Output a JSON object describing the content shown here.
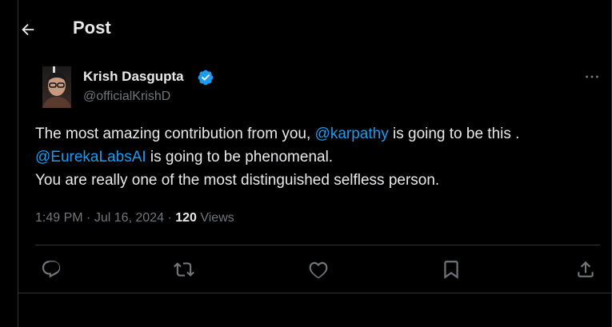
{
  "header": {
    "title": "Post"
  },
  "author": {
    "name": "Krish Dasgupta",
    "handle": "@officialKrishD"
  },
  "post": {
    "line1_prefix": "The most amazing contribution from you, ",
    "line1_mention": "@karpathy",
    "line1_suffix": " is going to be this .",
    "line2_mention": "@EurekaLabsAI",
    "line2_suffix": " is going to be phenomenal.",
    "line3": "You are really one of the most distinguished selfless person."
  },
  "meta": {
    "time": "1:49 PM",
    "dot1": " · ",
    "date": "Jul 16, 2024",
    "dot2": " · ",
    "views_count": "120",
    "views_label": " Views"
  },
  "icons": {
    "back": "arrow-left-icon",
    "verified": "verified-badge-icon",
    "more": "more-horizontal-icon",
    "reply": "reply-icon",
    "repost": "repost-icon",
    "like": "heart-icon",
    "bookmark": "bookmark-icon",
    "share": "share-icon"
  },
  "colors": {
    "background": "#000000",
    "text": "#e7e9ea",
    "muted": "#71767b",
    "accent": "#1d9bf0",
    "border": "#2f3336"
  }
}
